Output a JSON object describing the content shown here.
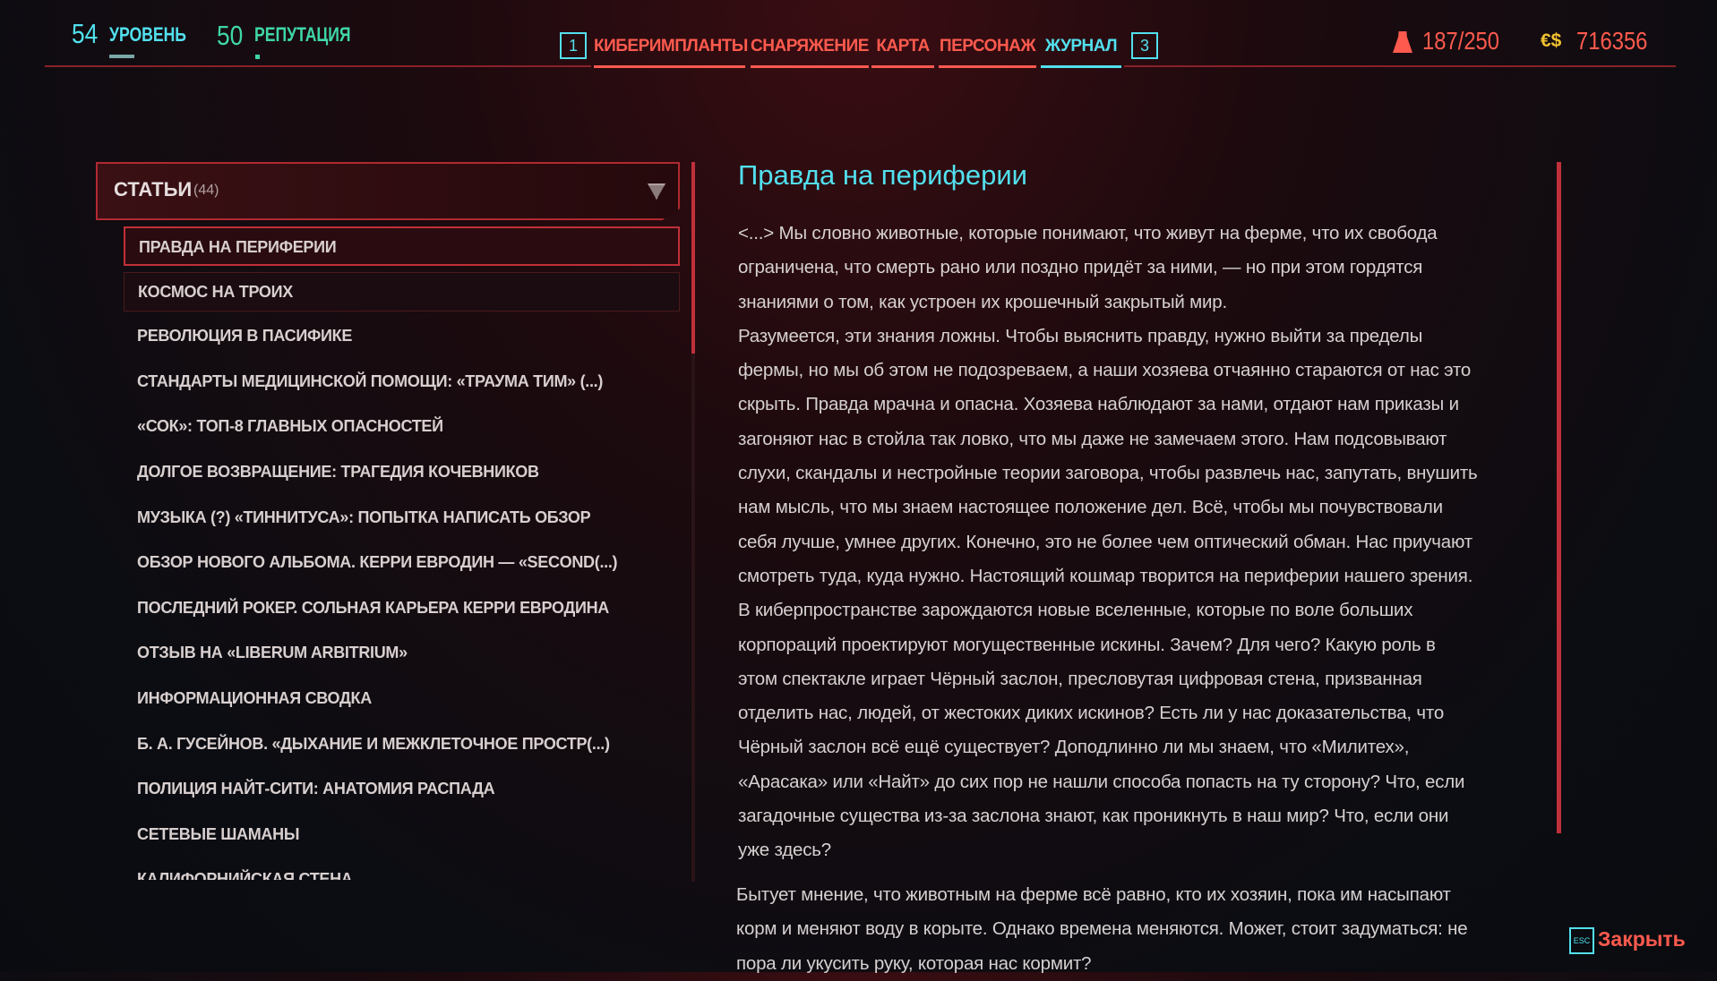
{
  "stats": {
    "level_value": "54",
    "level_label": "УРОВЕНЬ",
    "rep_value": "50",
    "rep_label": "РЕПУТАЦИЯ"
  },
  "nav": {
    "prev_key": "1",
    "next_key": "3",
    "tabs": [
      "КИБЕРИМПЛАНТЫ",
      "СНАРЯЖЕНИЕ",
      "КАРТА",
      "ПЕРСОНАЖ",
      "ЖУРНАЛ"
    ],
    "active": "ЖУРНАЛ"
  },
  "carry": {
    "weight": "187/250",
    "currency_symbol": "€$",
    "money": "716356"
  },
  "list": {
    "header": "СТАТЬИ",
    "count": "(44)",
    "items": [
      "ПРАВДА НА ПЕРИФЕРИИ",
      "КОСМОС НА ТРОИХ",
      "РЕВОЛЮЦИЯ В ПАСИФИКЕ",
      "СТАНДАРТЫ МЕДИЦИНСКОЙ ПОМОЩИ: «ТРАУМА ТИМ» (...)",
      "«СОК»: ТОП-8 ГЛАВНЫХ ОПАСНОСТЕЙ",
      "ДОЛГОЕ ВОЗВРАЩЕНИЕ: ТРАГЕДИЯ КОЧЕВНИКОВ",
      "МУЗЫКА (?) «ТИННИТУСА»: ПОПЫТКА НАПИСАТЬ ОБЗОР",
      "ОБЗОР НОВОГО АЛЬБОМА. КЕРРИ ЕВРОДИН — «SECOND(...)",
      "ПОСЛЕДНИЙ РОКЕР. СОЛЬНАЯ КАРЬЕРА КЕРРИ ЕВРОДИНА",
      "ОТЗЫВ НА «LIBERUM ARBITRIUM»",
      "ИНФОРМАЦИОННАЯ СВОДКА",
      "Б. А. ГУСЕЙНОВ. «ДЫХАНИЕ И МЕЖКЛЕТОЧНОЕ ПРОСТР(...)",
      "ПОЛИЦИЯ НАЙТ-СИТИ: АНАТОМИЯ РАСПАДА",
      "СЕТЕВЫЕ ШАМАНЫ",
      "КАЛИФОРНИЙСКАЯ СТЕНА"
    ]
  },
  "article": {
    "title": "Правда на периферии",
    "lines": [
      "<...> Мы словно животные, которые понимают, что живут на ферме, что их свобода",
      "ограничена, что смерть рано или поздно придёт за ними, — но при этом гордятся",
      "знаниями о том, как устроен их крошечный закрытый мир.",
      "Разумеется, эти знания ложны. Чтобы выяснить правду, нужно выйти за пределы",
      "фермы, но мы об этом не подозреваем, а наши хозяева отчаянно стараются от нас это",
      "скрыть. Правда мрачна и опасна. Хозяева наблюдают за нами, отдают нам приказы и",
      "загоняют нас в стойла так ловко, что мы даже не замечаем этого. Нам подсовывают",
      "слухи, скандалы и нестройные теории заговора, чтобы развлечь нас, запутать, внушить",
      "нам мысль, что мы знаем настоящее положение дел. Всё, чтобы мы почувствовали",
      "себя лучше, умнее других. Конечно, это не более чем оптический обман. Нас приучают",
      "смотреть туда, куда нужно. Настоящий кошмар творится на периферии нашего зрения.",
      "В киберпространстве зарождаются новые вселенные, которые по воле больших",
      "корпораций проектируют могущественные искины. Зачем? Для чего? Какую роль в",
      "этом спектакле играет Чёрный заслон, пресловутая цифровая стена, призванная",
      "отделить нас, людей, от жестоких диких искинов? Есть ли у нас доказательства, что",
      "Чёрный заслон всё ещё существует? Доподлинно ли мы знаем, что «Милитех»,",
      "«Арасака» или «Найт» до сих пор не нашли способа попасть на ту сторону? Что, если",
      "загадочные существа из-за заслона знают, как проникнуть в наш мир? Что, если они",
      "уже здесь?"
    ],
    "tail_lines": [
      "Бытует мнение, что животным на ферме всё равно, кто их хозяин, пока им насыпают",
      "корм и меняют воду в корыте. Однако времена меняются. Может, стоит задуматься: не",
      "пора ли укусить руку, которая нас кормит?"
    ]
  },
  "footer": {
    "esc_key": "ESC",
    "close_label": "Закрыть"
  }
}
